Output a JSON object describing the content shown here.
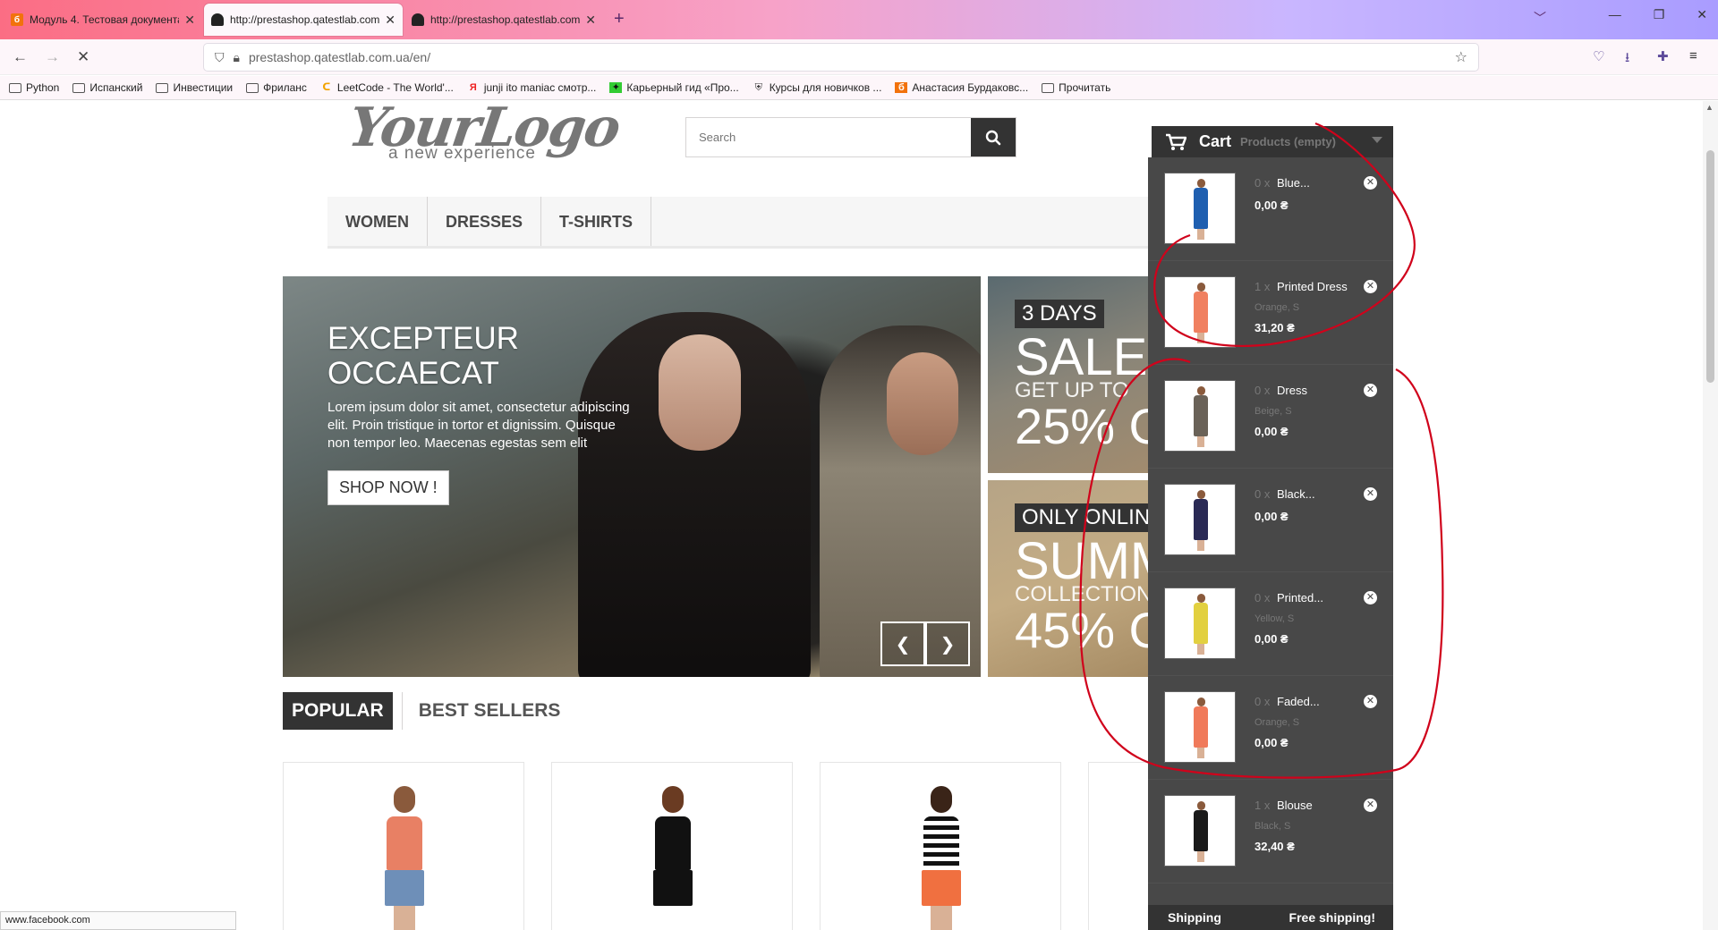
{
  "browser": {
    "tabs": [
      {
        "title": "Модуль 4. Тестовая документа",
        "active": false,
        "favicon_color": "#f2720c",
        "favicon_letter": "б"
      },
      {
        "title": "http://prestashop.qatestlab.com",
        "active": true,
        "favicon_color": "#222",
        "favicon_letter": ""
      },
      {
        "title": "http://prestashop.qatestlab.com",
        "active": false,
        "favicon_color": "#222",
        "favicon_letter": ""
      }
    ],
    "url": "prestashop.qatestlab.com.ua/en/",
    "bookmarks": [
      {
        "label": "Python",
        "icon": "folder-icon"
      },
      {
        "label": "Испанский",
        "icon": "folder-icon"
      },
      {
        "label": "Инвестиции",
        "icon": "folder-icon"
      },
      {
        "label": "Фриланс",
        "icon": "folder-icon"
      },
      {
        "label": "LeetCode - The World'...",
        "icon": "leetcode-icon"
      },
      {
        "label": "junji ito maniac смотр...",
        "icon": "yandex-icon"
      },
      {
        "label": "Карьерный гид «Про...",
        "icon": "guide-icon"
      },
      {
        "label": "Курсы для новичков ...",
        "icon": "shield-icon"
      },
      {
        "label": "Анастасия Бурдаковс...",
        "icon": "b-icon"
      },
      {
        "label": "Прочитать",
        "icon": "folder-icon"
      }
    ],
    "status_url": "www.facebook.com"
  },
  "shop": {
    "logo_main": "YourLogo",
    "logo_sub": "a new experience",
    "search_placeholder": "Search",
    "menu": [
      "WOMEN",
      "DRESSES",
      "T-SHIRTS"
    ],
    "slider": {
      "title_line1": "EXCEPTEUR",
      "title_line2": "OCCAECAT",
      "text": "Lorem ipsum dolor sit amet, consectetur adipiscing elit. Proin tristique in tortor et dignissim. Quisque non tempor leo. Maecenas egestas sem elit",
      "button": "SHOP NOW !"
    },
    "banner1": {
      "tag": "3 DAYS",
      "big": "SALE",
      "mid": "GET UP TO",
      "pct": "25% O"
    },
    "banner2": {
      "tag": "ONLY ONLIN",
      "big": "SUMM",
      "mid": "COLLECTION",
      "pct": "45% O"
    },
    "product_tabs": [
      "POPULAR",
      "BEST SELLERS"
    ]
  },
  "cart": {
    "label": "Cart",
    "summary": "Products (empty)",
    "items": [
      {
        "qty": "0 x",
        "name": "Blue...",
        "attr": "",
        "price": "0,00 ₴",
        "color": "#1f5fb0"
      },
      {
        "qty": "1 x",
        "name": "Printed Dress",
        "attr": "Orange, S",
        "price": "31,20 ₴",
        "color": "#f08060"
      },
      {
        "qty": "0 x",
        "name": "Dress",
        "attr": "Beige, S",
        "price": "0,00 ₴",
        "color": "#6a6258"
      },
      {
        "qty": "0 x",
        "name": "Black...",
        "attr": "",
        "price": "0,00 ₴",
        "color": "#2a2a55"
      },
      {
        "qty": "0 x",
        "name": "Printed...",
        "attr": "Yellow, S",
        "price": "0,00 ₴",
        "color": "#e2d040"
      },
      {
        "qty": "0 x",
        "name": "Faded...",
        "attr": "Orange, S",
        "price": "0,00 ₴",
        "color": "#f07a5a"
      },
      {
        "qty": "1 x",
        "name": "Blouse",
        "attr": "Black, S",
        "price": "32,40 ₴",
        "color": "#1a1a1a"
      }
    ],
    "shipping_label": "Shipping",
    "shipping_value": "Free shipping!"
  },
  "colors": {
    "annotation": "#d0021b",
    "cart_bg": "#484848",
    "dark": "#333333"
  }
}
